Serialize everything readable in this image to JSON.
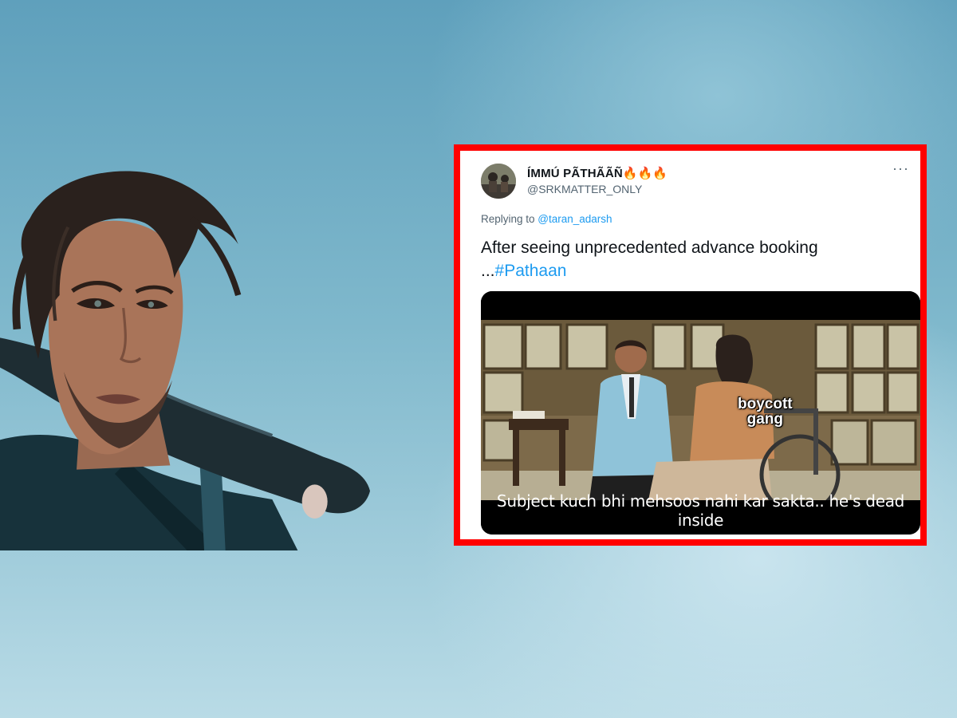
{
  "tweet": {
    "display_name": "ÍMMÚ PÃTHÃÃÑ",
    "emoji": "🔥🔥🔥",
    "handle": "@SRKMATTER_ONLY",
    "replying_prefix": "Replying to ",
    "replying_to": "@taran_adarsh",
    "text_line1": "After seeing unprecedented advance booking",
    "text_prefix": "...",
    "hashtag": "#Pathaan",
    "more": "···"
  },
  "meme": {
    "label_boycott": "boycott",
    "label_gang": "gang",
    "caption": "Subject kuch bhi mehsoos nahi kar sakta.. he's dead inside"
  },
  "colors": {
    "frame": "#ff0000",
    "link": "#1d9bf0",
    "text": "#0f1419",
    "muted": "#536471"
  }
}
